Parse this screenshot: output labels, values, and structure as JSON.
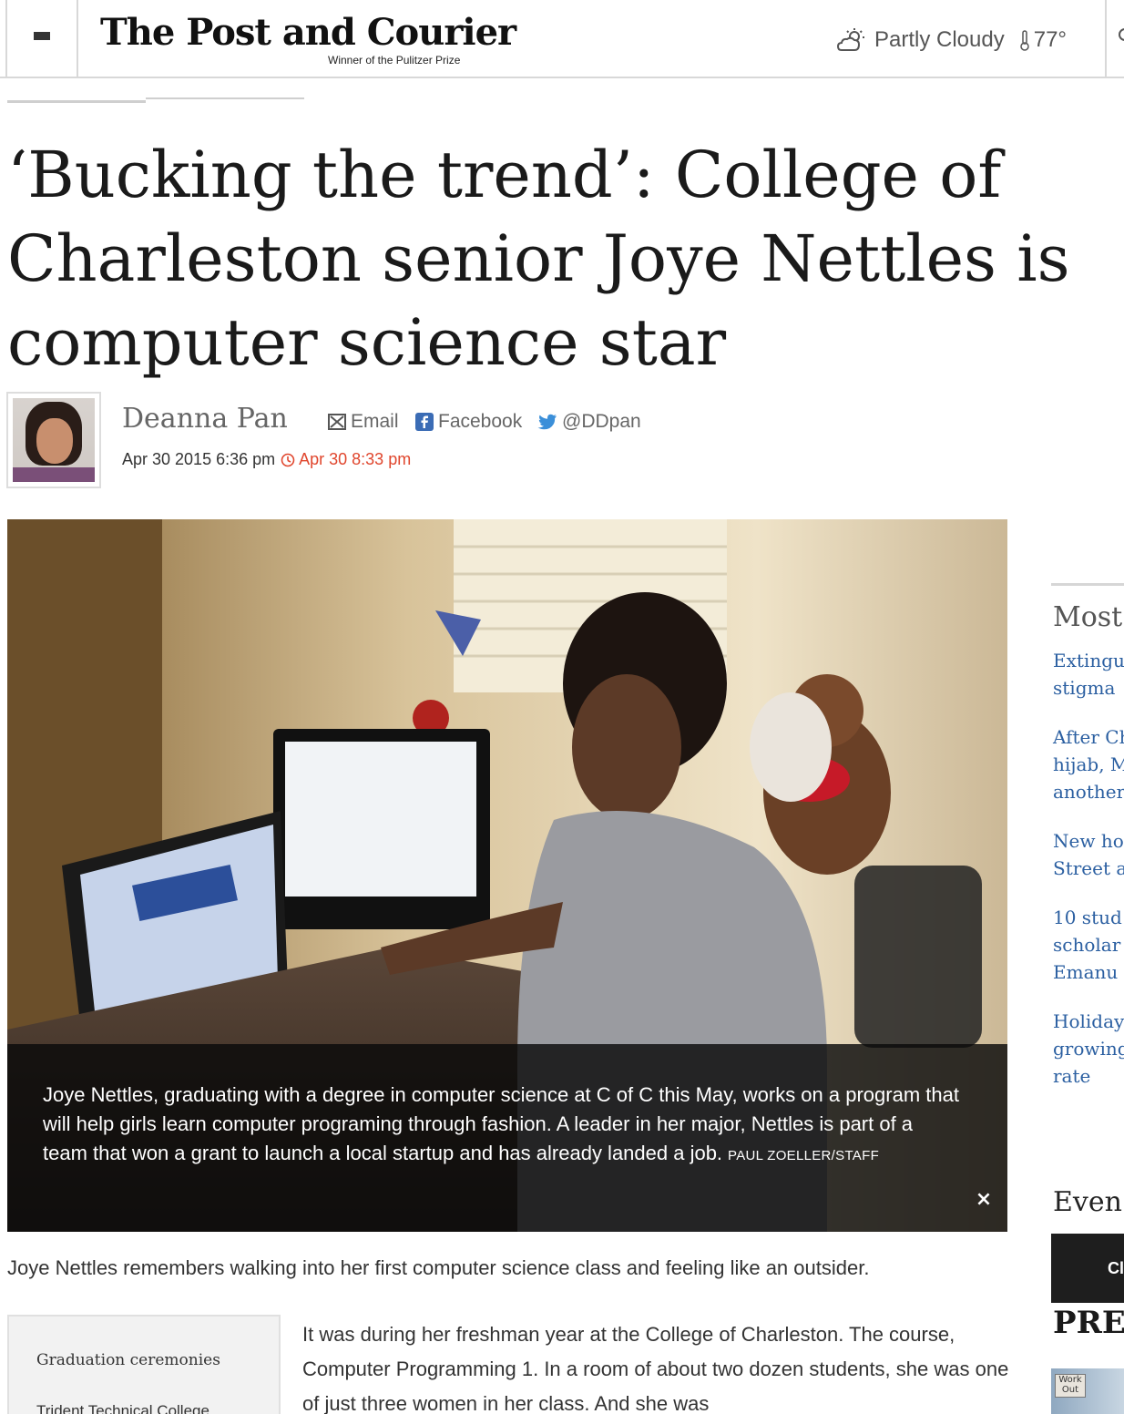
{
  "header": {
    "masthead": "The Post and Courier",
    "tagline": "Winner of the Pulitzer Prize",
    "weather": {
      "condition": "Partly Cloudy",
      "temperature": "77°",
      "icon": "partly-cloudy-icon"
    }
  },
  "article": {
    "headline": "‘Bucking the trend’: College of Charleston senior Joye Nettles is computer science star",
    "author": "Deanna Pan",
    "share": {
      "email_label": "Email",
      "facebook_label": "Facebook",
      "twitter_label": "@DDpan"
    },
    "published": "Apr 30 2015 6:36 pm",
    "updated": "Apr 30 8:33 pm",
    "photo": {
      "caption": "Joye Nettles, graduating with a degree in computer science at C of C this May, works on a program that will help girls learn computer programing through fashion. A leader in her major, Nettles is part of a team that won a grant to launch a local startup and has already landed a job.",
      "credit": "PAUL ZOELLER/STAFF",
      "close_label": "×"
    },
    "lead": "Joye Nettles remembers walking into her first computer science class and feeling like an outsider.",
    "body": "It was during her freshman year at the College of Charleston. The course, Computer Programming 1. In a room of about two dozen students, she was one of just three women in her class. And she was",
    "sidebox": {
      "title": "Graduation ceremonies",
      "item": "Trident Technical College"
    }
  },
  "rail": {
    "heading": "Most",
    "links": [
      {
        "text": "Extingu\nstigma"
      },
      {
        "text": "After Ch\nhijab, M\nanother"
      },
      {
        "text": "New ho\nStreet a"
      },
      {
        "text": "10 stud\nscholar\nEmanu"
      },
      {
        "text": "Holiday\ngrowing\nrate"
      }
    ],
    "heading2": "Even",
    "promo_text": "Cl",
    "pre_text": "PRE",
    "thumb_text": "Work Out"
  }
}
